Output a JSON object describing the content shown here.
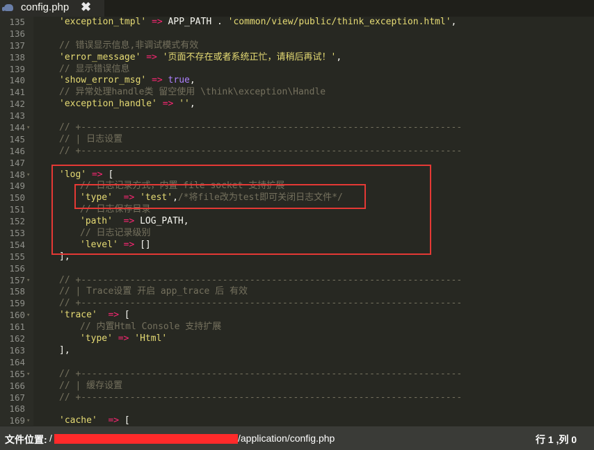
{
  "tab": {
    "filename": "config.php",
    "close_glyph": "✖"
  },
  "status": {
    "label": "文件位置:",
    "path_prefix": "/",
    "path_suffix": "/application/config.php",
    "position": "行 1 ,列 0"
  },
  "lines": [
    {
      "n": "135",
      "fold": "",
      "indent": 0,
      "tokens": [
        [
          "s",
          "'exception_tmpl'"
        ],
        [
          "p",
          " "
        ],
        [
          "o",
          "=>"
        ],
        [
          "p",
          " APP_PATH . "
        ],
        [
          "s",
          "'common/view/public/think_exception.html'"
        ],
        [
          "p",
          ","
        ]
      ]
    },
    {
      "n": "136",
      "fold": "",
      "indent": 0,
      "tokens": []
    },
    {
      "n": "137",
      "fold": "",
      "indent": 0,
      "tokens": [
        [
          "c",
          "// 错误显示信息,非调试模式有效"
        ]
      ]
    },
    {
      "n": "138",
      "fold": "",
      "indent": 0,
      "tokens": [
        [
          "s",
          "'error_message'"
        ],
        [
          "p",
          " "
        ],
        [
          "o",
          "=>"
        ],
        [
          "p",
          " "
        ],
        [
          "s",
          "'页面不存在或者系统正忙，请稍后再试！'"
        ],
        [
          "p",
          ","
        ]
      ]
    },
    {
      "n": "139",
      "fold": "",
      "indent": 0,
      "tokens": [
        [
          "c",
          "// 显示错误信息"
        ]
      ]
    },
    {
      "n": "140",
      "fold": "",
      "indent": 0,
      "tokens": [
        [
          "s",
          "'show_error_msg'"
        ],
        [
          "p",
          " "
        ],
        [
          "o",
          "=>"
        ],
        [
          "p",
          " "
        ],
        [
          "k",
          "true"
        ],
        [
          "p",
          ","
        ]
      ]
    },
    {
      "n": "141",
      "fold": "",
      "indent": 0,
      "tokens": [
        [
          "c",
          "// 异常处理handle类 留空使用 \\think\\exception\\Handle"
        ]
      ]
    },
    {
      "n": "142",
      "fold": "",
      "indent": 0,
      "tokens": [
        [
          "s",
          "'exception_handle'"
        ],
        [
          "p",
          " "
        ],
        [
          "o",
          "=>"
        ],
        [
          "p",
          " "
        ],
        [
          "s",
          "''"
        ],
        [
          "p",
          ","
        ]
      ]
    },
    {
      "n": "143",
      "fold": "",
      "indent": 0,
      "tokens": []
    },
    {
      "n": "144",
      "fold": "▾",
      "indent": 0,
      "tokens": [
        [
          "c",
          "// +----------------------------------------------------------------------"
        ]
      ]
    },
    {
      "n": "145",
      "fold": "",
      "indent": 0,
      "tokens": [
        [
          "c",
          "// | 日志设置"
        ]
      ]
    },
    {
      "n": "146",
      "fold": "",
      "indent": 0,
      "tokens": [
        [
          "c",
          "// +----------------------------------------------------------------------"
        ]
      ]
    },
    {
      "n": "147",
      "fold": "",
      "indent": 0,
      "tokens": []
    },
    {
      "n": "148",
      "fold": "▾",
      "indent": 0,
      "tokens": [
        [
          "s",
          "'log'"
        ],
        [
          "p",
          " "
        ],
        [
          "o",
          "=>"
        ],
        [
          "p",
          " ["
        ]
      ]
    },
    {
      "n": "149",
      "fold": "",
      "indent": 1,
      "tokens": [
        [
          "c",
          "// 日志记录方式，内置 file socket 支持扩展"
        ]
      ]
    },
    {
      "n": "150",
      "fold": "",
      "indent": 1,
      "tokens": [
        [
          "s",
          "'type'"
        ],
        [
          "p",
          "  "
        ],
        [
          "o",
          "=>"
        ],
        [
          "p",
          " "
        ],
        [
          "s",
          "'test'"
        ],
        [
          "p",
          ","
        ],
        [
          "c",
          "/*将file改为test即可关闭日志文件*/"
        ]
      ]
    },
    {
      "n": "151",
      "fold": "",
      "indent": 1,
      "tokens": [
        [
          "c",
          "// 日志保存目录"
        ]
      ]
    },
    {
      "n": "152",
      "fold": "",
      "indent": 1,
      "tokens": [
        [
          "s",
          "'path'"
        ],
        [
          "p",
          "  "
        ],
        [
          "o",
          "=>"
        ],
        [
          "p",
          " LOG_PATH,"
        ]
      ]
    },
    {
      "n": "153",
      "fold": "",
      "indent": 1,
      "tokens": [
        [
          "c",
          "// 日志记录级别"
        ]
      ]
    },
    {
      "n": "154",
      "fold": "",
      "indent": 1,
      "tokens": [
        [
          "s",
          "'level'"
        ],
        [
          "p",
          " "
        ],
        [
          "o",
          "=>"
        ],
        [
          "p",
          " []"
        ]
      ]
    },
    {
      "n": "155",
      "fold": "",
      "indent": 0,
      "tokens": [
        [
          "p",
          "],"
        ]
      ]
    },
    {
      "n": "156",
      "fold": "",
      "indent": 0,
      "tokens": []
    },
    {
      "n": "157",
      "fold": "▾",
      "indent": 0,
      "tokens": [
        [
          "c",
          "// +----------------------------------------------------------------------"
        ]
      ]
    },
    {
      "n": "158",
      "fold": "",
      "indent": 0,
      "tokens": [
        [
          "c",
          "// | Trace设置 开启 app_trace 后 有效"
        ]
      ]
    },
    {
      "n": "159",
      "fold": "",
      "indent": 0,
      "tokens": [
        [
          "c",
          "// +----------------------------------------------------------------------"
        ]
      ]
    },
    {
      "n": "160",
      "fold": "▾",
      "indent": 0,
      "tokens": [
        [
          "s",
          "'trace'"
        ],
        [
          "p",
          "  "
        ],
        [
          "o",
          "=>"
        ],
        [
          "p",
          " ["
        ]
      ]
    },
    {
      "n": "161",
      "fold": "",
      "indent": 1,
      "tokens": [
        [
          "c",
          "// 内置Html Console 支持扩展"
        ]
      ]
    },
    {
      "n": "162",
      "fold": "",
      "indent": 1,
      "tokens": [
        [
          "s",
          "'type'"
        ],
        [
          "p",
          " "
        ],
        [
          "o",
          "=>"
        ],
        [
          "p",
          " "
        ],
        [
          "s",
          "'Html'"
        ]
      ]
    },
    {
      "n": "163",
      "fold": "",
      "indent": 0,
      "tokens": [
        [
          "p",
          "],"
        ]
      ]
    },
    {
      "n": "164",
      "fold": "",
      "indent": 0,
      "tokens": []
    },
    {
      "n": "165",
      "fold": "▾",
      "indent": 0,
      "tokens": [
        [
          "c",
          "// +----------------------------------------------------------------------"
        ]
      ]
    },
    {
      "n": "166",
      "fold": "",
      "indent": 0,
      "tokens": [
        [
          "c",
          "// | 缓存设置"
        ]
      ]
    },
    {
      "n": "167",
      "fold": "",
      "indent": 0,
      "tokens": [
        [
          "c",
          "// +----------------------------------------------------------------------"
        ]
      ]
    },
    {
      "n": "168",
      "fold": "",
      "indent": 0,
      "tokens": []
    },
    {
      "n": "169",
      "fold": "▾",
      "indent": 0,
      "tokens": [
        [
          "s",
          "'cache'"
        ],
        [
          "p",
          "  "
        ],
        [
          "o",
          "=>"
        ],
        [
          "p",
          " ["
        ]
      ]
    }
  ]
}
